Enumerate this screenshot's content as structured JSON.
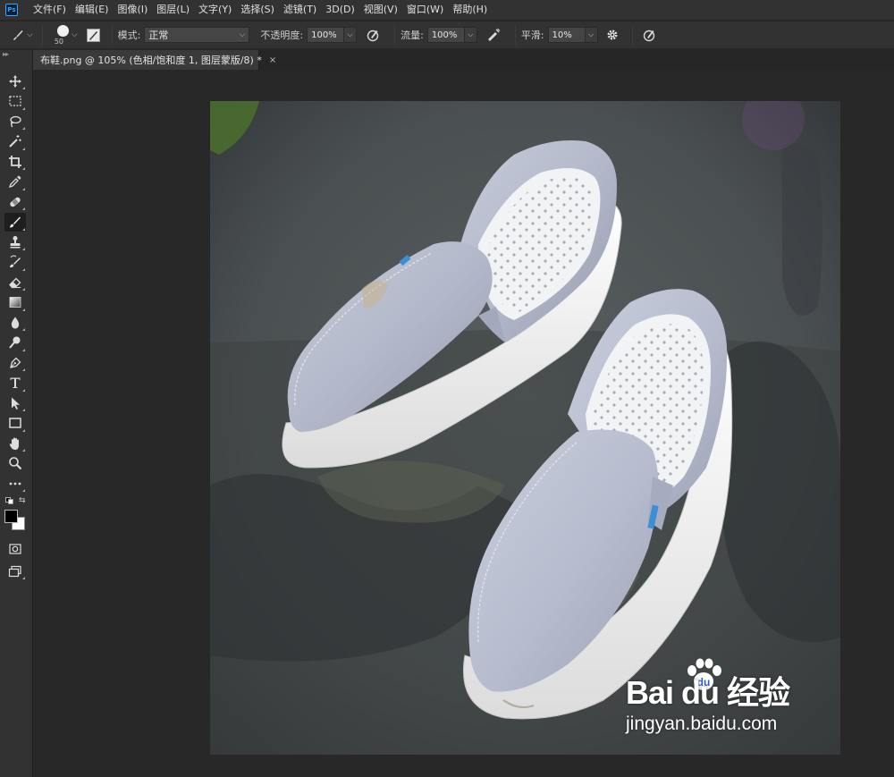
{
  "app": {
    "logo": "Ps"
  },
  "menu": {
    "items": [
      "文件(F)",
      "编辑(E)",
      "图像(I)",
      "图层(L)",
      "文字(Y)",
      "选择(S)",
      "滤镜(T)",
      "3D(D)",
      "视图(V)",
      "窗口(W)",
      "帮助(H)"
    ]
  },
  "options": {
    "brush_size": "50",
    "mode_label": "模式:",
    "mode_value": "正常",
    "opacity_label": "不透明度:",
    "opacity_value": "100%",
    "flow_label": "流量:",
    "flow_value": "100%",
    "smoothing_label": "平滑:",
    "smoothing_value": "10%"
  },
  "document": {
    "tab_title": "布鞋.png @ 105% (色相/饱和度 1, 图层蒙版/8) *",
    "close_glyph": "×"
  },
  "tools": [
    "move-tool",
    "marquee-tool",
    "lasso-tool",
    "magic-wand-tool",
    "crop-tool",
    "eyedropper-tool",
    "healing-brush-tool",
    "brush-tool",
    "clone-stamp-tool",
    "history-brush-tool",
    "eraser-tool",
    "gradient-tool",
    "blur-tool",
    "dodge-tool",
    "pen-tool",
    "type-tool",
    "path-selection-tool",
    "rectangle-tool",
    "hand-tool",
    "zoom-tool",
    "more-tools"
  ],
  "active_tool": "brush-tool",
  "colors": {
    "foreground": "#000000",
    "background": "#ffffff",
    "ui_dark": "#323232",
    "canvas_bg": "#282828"
  },
  "watermark": {
    "brand": "Bai  du 经验",
    "url": "jingyan.baidu.com"
  }
}
